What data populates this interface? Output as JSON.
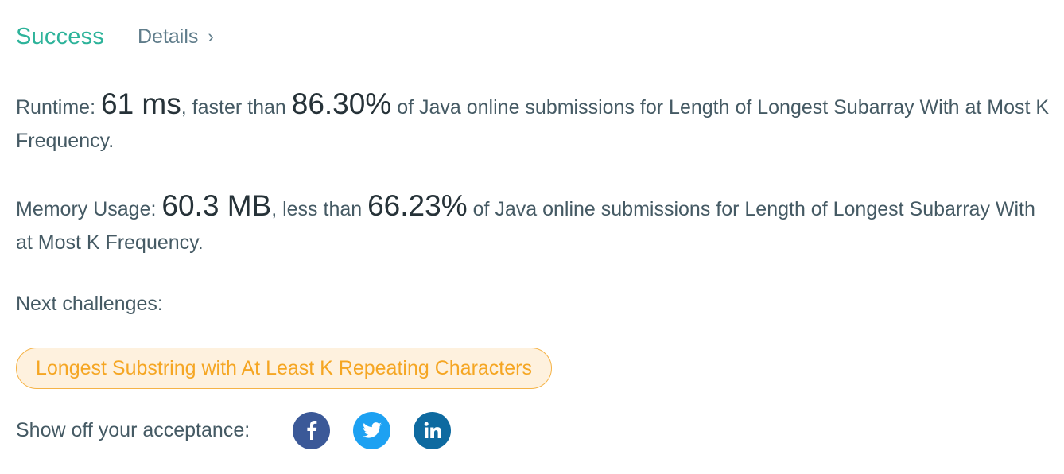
{
  "result": {
    "status": "Success",
    "details_label": "Details",
    "details_chevron": "›"
  },
  "runtime": {
    "label": "Runtime:",
    "value": "61 ms",
    "comparison": ", faster than",
    "percentile": "86.30%",
    "suffix": "of Java online submissions for Length of Longest Subarray With at Most K Frequency."
  },
  "memory": {
    "label": "Memory Usage:",
    "value": "60.3 MB",
    "comparison": ", less than",
    "percentile": "66.23%",
    "suffix": "of Java online submissions for Length of Longest Subarray With at Most K Frequency."
  },
  "next": {
    "label": "Next challenges:",
    "items": [
      {
        "title": "Longest Substring with At Least K Repeating Characters"
      }
    ]
  },
  "share": {
    "label": "Show off your acceptance:",
    "networks": [
      {
        "name": "facebook",
        "icon": "facebook-icon",
        "color": "#3b5998"
      },
      {
        "name": "twitter",
        "icon": "twitter-icon",
        "color": "#1da1f2"
      },
      {
        "name": "linkedin",
        "icon": "linkedin-icon",
        "color": "#0e6aa0"
      }
    ]
  },
  "colors": {
    "success": "#2db39a",
    "text": "#455a64",
    "emphasis": "#263238",
    "challenge_border": "#f5b347",
    "challenge_bg": "#fef1de",
    "challenge_text": "#f5a623"
  }
}
